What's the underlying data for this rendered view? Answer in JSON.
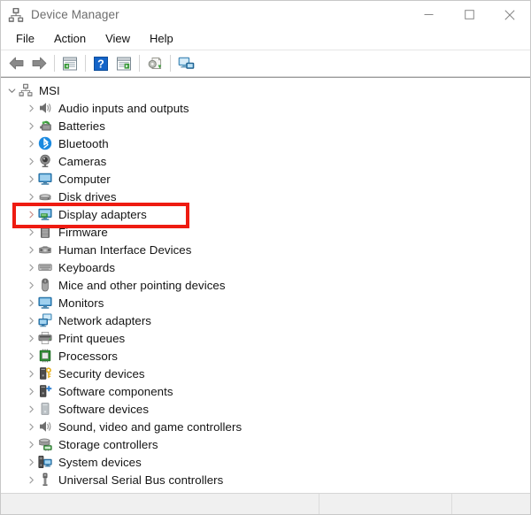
{
  "window": {
    "title": "Device Manager",
    "app_icon": "device-manager-icon",
    "controls": {
      "minimize_label": "Minimize",
      "maximize_label": "Maximize",
      "close_label": "Close"
    }
  },
  "menubar": {
    "items": [
      {
        "label": "File",
        "name": "menu-file"
      },
      {
        "label": "Action",
        "name": "menu-action"
      },
      {
        "label": "View",
        "name": "menu-view"
      },
      {
        "label": "Help",
        "name": "menu-help"
      }
    ]
  },
  "toolbar": {
    "buttons": [
      {
        "name": "back-button",
        "icon": "back-arrow-icon",
        "tooltip": "Back"
      },
      {
        "name": "forward-button",
        "icon": "forward-arrow-icon",
        "tooltip": "Forward"
      },
      {
        "name": "properties-button",
        "icon": "properties-icon",
        "tooltip": "Properties"
      },
      {
        "name": "help-button",
        "icon": "help-question-icon",
        "tooltip": "Help"
      },
      {
        "name": "update-driver-button",
        "icon": "update-driver-icon",
        "tooltip": "Update driver"
      },
      {
        "name": "scan-hardware-button",
        "icon": "scan-hardware-changes-icon",
        "tooltip": "Scan for hardware changes"
      },
      {
        "name": "show-hidden-devices-button",
        "icon": "monitor-devices-icon",
        "tooltip": "Show hidden devices"
      }
    ]
  },
  "tree": {
    "root": {
      "label": "MSI",
      "icon": "computer-root-icon",
      "expanded": true
    },
    "items": [
      {
        "label": "Audio inputs and outputs",
        "icon": "speaker-icon",
        "name": "tree-item-audio-inputs-and-outputs"
      },
      {
        "label": "Batteries",
        "icon": "battery-icon",
        "name": "tree-item-batteries"
      },
      {
        "label": "Bluetooth",
        "icon": "bluetooth-icon",
        "name": "tree-item-bluetooth"
      },
      {
        "label": "Cameras",
        "icon": "camera-icon",
        "name": "tree-item-cameras"
      },
      {
        "label": "Computer",
        "icon": "monitor-icon",
        "name": "tree-item-computer"
      },
      {
        "label": "Disk drives",
        "icon": "disk-drive-icon",
        "name": "tree-item-disk-drives"
      },
      {
        "label": "Display adapters",
        "icon": "display-adapter-icon",
        "name": "tree-item-display-adapters",
        "highlighted": true
      },
      {
        "label": "Firmware",
        "icon": "firmware-chip-icon",
        "name": "tree-item-firmware"
      },
      {
        "label": "Human Interface Devices",
        "icon": "hid-icon",
        "name": "tree-item-human-interface-devices"
      },
      {
        "label": "Keyboards",
        "icon": "keyboard-icon",
        "name": "tree-item-keyboards"
      },
      {
        "label": "Mice and other pointing devices",
        "icon": "mouse-icon",
        "name": "tree-item-mice-and-other-pointing-devices"
      },
      {
        "label": "Monitors",
        "icon": "monitor-icon",
        "name": "tree-item-monitors"
      },
      {
        "label": "Network adapters",
        "icon": "network-adapter-icon",
        "name": "tree-item-network-adapters"
      },
      {
        "label": "Print queues",
        "icon": "printer-icon",
        "name": "tree-item-print-queues"
      },
      {
        "label": "Processors",
        "icon": "processor-icon",
        "name": "tree-item-processors"
      },
      {
        "label": "Security devices",
        "icon": "security-device-icon",
        "name": "tree-item-security-devices"
      },
      {
        "label": "Software components",
        "icon": "software-component-icon",
        "name": "tree-item-software-components"
      },
      {
        "label": "Software devices",
        "icon": "software-device-icon",
        "name": "tree-item-software-devices"
      },
      {
        "label": "Sound, video and game controllers",
        "icon": "speaker-icon",
        "name": "tree-item-sound-video-and-game-controllers"
      },
      {
        "label": "Storage controllers",
        "icon": "storage-controller-icon",
        "name": "tree-item-storage-controllers"
      },
      {
        "label": "System devices",
        "icon": "system-device-icon",
        "name": "tree-item-system-devices"
      },
      {
        "label": "Universal Serial Bus controllers",
        "icon": "usb-icon",
        "name": "tree-item-universal-serial-bus-controllers"
      }
    ]
  },
  "highlight": {
    "color": "#ee1b11",
    "target": "Display adapters"
  },
  "statusbar": {
    "pane1": "",
    "pane2": "",
    "pane3": ""
  }
}
